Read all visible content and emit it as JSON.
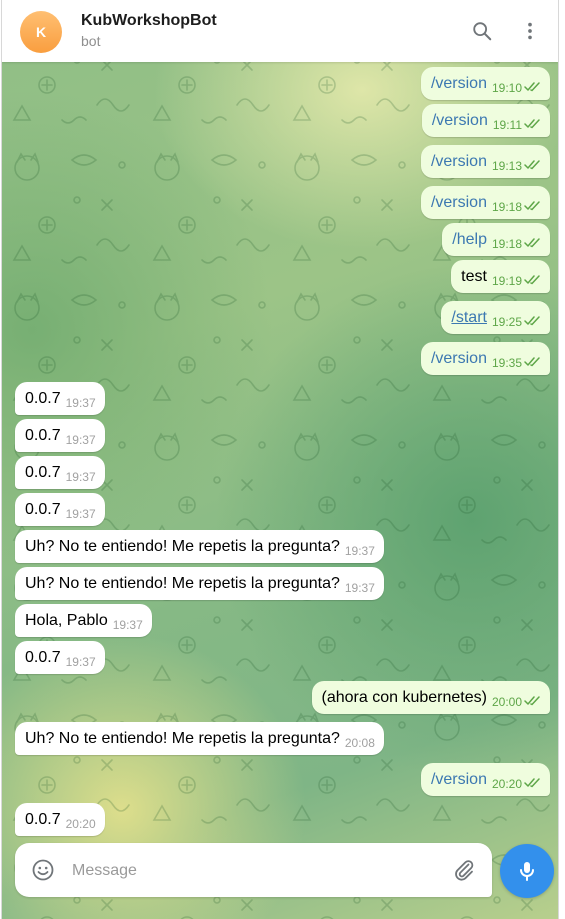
{
  "header": {
    "avatar_letter": "K",
    "title": "KubWorkshopBot",
    "subtitle": "bot"
  },
  "messages": [
    {
      "dir": "out",
      "text": "/version",
      "time": "19:10",
      "type": "command"
    },
    {
      "dir": "out",
      "text": "/version",
      "time": "19:11",
      "type": "command"
    },
    {
      "dir": "out",
      "text": "/version",
      "time": "19:13",
      "type": "command"
    },
    {
      "dir": "out",
      "text": "/version",
      "time": "19:18",
      "type": "command"
    },
    {
      "dir": "out",
      "text": "/help",
      "time": "19:18",
      "type": "command"
    },
    {
      "dir": "out",
      "text": "test",
      "time": "19:19",
      "type": "text"
    },
    {
      "dir": "out",
      "text": "/start",
      "time": "19:25",
      "type": "link"
    },
    {
      "dir": "out",
      "text": "/version",
      "time": "19:35",
      "type": "command"
    },
    {
      "dir": "in",
      "text": "0.0.7",
      "time": "19:37",
      "type": "text"
    },
    {
      "dir": "in",
      "text": "0.0.7",
      "time": "19:37",
      "type": "text"
    },
    {
      "dir": "in",
      "text": "0.0.7",
      "time": "19:37",
      "type": "text"
    },
    {
      "dir": "in",
      "text": "0.0.7",
      "time": "19:37",
      "type": "text"
    },
    {
      "dir": "in",
      "text": "Uh? No te entiendo! Me repetis la pregunta?",
      "time": "19:37",
      "type": "text"
    },
    {
      "dir": "in",
      "text": "Uh? No te entiendo! Me repetis la pregunta?",
      "time": "19:37",
      "type": "text"
    },
    {
      "dir": "in",
      "text": "Hola, Pablo",
      "time": "19:37",
      "type": "text"
    },
    {
      "dir": "in",
      "text": "0.0.7",
      "time": "19:37",
      "type": "text"
    },
    {
      "dir": "out",
      "text": "(ahora con kubernetes)",
      "time": "20:00",
      "type": "text"
    },
    {
      "dir": "in",
      "text": "Uh? No te entiendo! Me repetis la pregunta?",
      "time": "20:08",
      "type": "text"
    },
    {
      "dir": "out",
      "text": "/version",
      "time": "20:20",
      "type": "command"
    },
    {
      "dir": "in",
      "text": "0.0.7",
      "time": "20:20",
      "type": "text"
    }
  ],
  "composer": {
    "placeholder": "Message",
    "emoji_icon": "smile-icon",
    "attach_icon": "paperclip-icon",
    "mic_icon": "microphone-icon"
  },
  "colors": {
    "outgoing_bubble": "#effdde",
    "incoming_bubble": "#ffffff",
    "command_link": "#3c78b1",
    "read_check": "#5ea648",
    "accent": "#3390ec",
    "avatar": "#f99e3f"
  }
}
